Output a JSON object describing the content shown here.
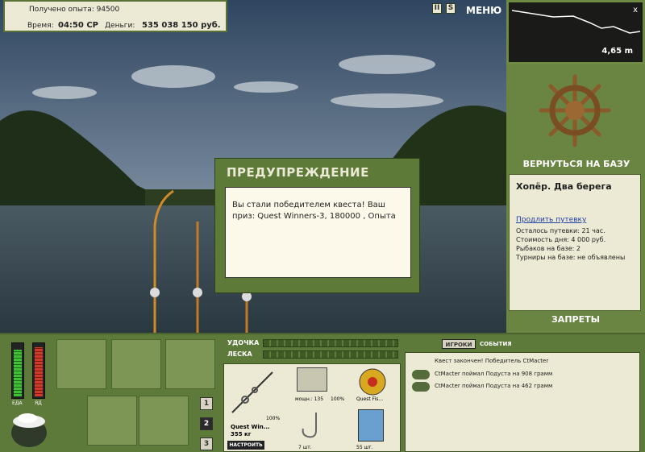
{
  "hud": {
    "xp_line": "Получено опыта: 94500",
    "time_label": "Время:",
    "time_value": "04:50 CP",
    "money_label": "Деньги:",
    "money_value": "535 038 150 руб."
  },
  "top_buttons": {
    "pause": "II",
    "sound": "S",
    "menu": "МЕНЮ"
  },
  "depth": {
    "value": "4,65 m",
    "close": "x"
  },
  "right_panel": {
    "return_label": "ВЕРНУТЬСЯ НА БАЗУ",
    "location_title": "Хопёр. Два берега",
    "extend_link": "Продлить путевку",
    "trip_left": "Осталось путевки: 21 час.",
    "day_cost": "Стоимость дня: 4 000 руб.",
    "fishers": "Рыбаков на базе: 2",
    "tournaments": "Турниры на базе: не объявлены",
    "bans_label": "ЗАПРЕТЫ"
  },
  "meters": {
    "food_label": "ЕДА",
    "poison_label": "ЯД",
    "food_level": 0.9,
    "poison_level": 0.95
  },
  "slots": [
    "1",
    "2",
    "3"
  ],
  "tackle": {
    "rod_label": "УДОЧКА",
    "line_label": "ЛЕСКА",
    "rod_name": "Quest Win...",
    "rod_weight": "355 кг",
    "rod_pct": "100%",
    "setup_btn": "НАСТРОИТЬ",
    "reel_power": "мощн.: 135",
    "reel_pct": "100%",
    "line_name": "Quest Fis...",
    "hook_count": "7 шт.",
    "bait_count": "55 шт."
  },
  "chat": {
    "tab_players": "ИГРОКИ",
    "tab_events": "СОБЫТИЯ",
    "messages": [
      "Квест закончен! Победитель CtMacter",
      "CtMacter поймал Подуста на 908 грамм",
      "CtMacter поймал Подуста на 462 грамм"
    ]
  },
  "dialog": {
    "title": "ПРЕДУПРЕЖДЕНИЕ",
    "message": "Вы стали победителем квеста! Ваш приз: Quest Winners-3, 180000 , Опыта"
  }
}
